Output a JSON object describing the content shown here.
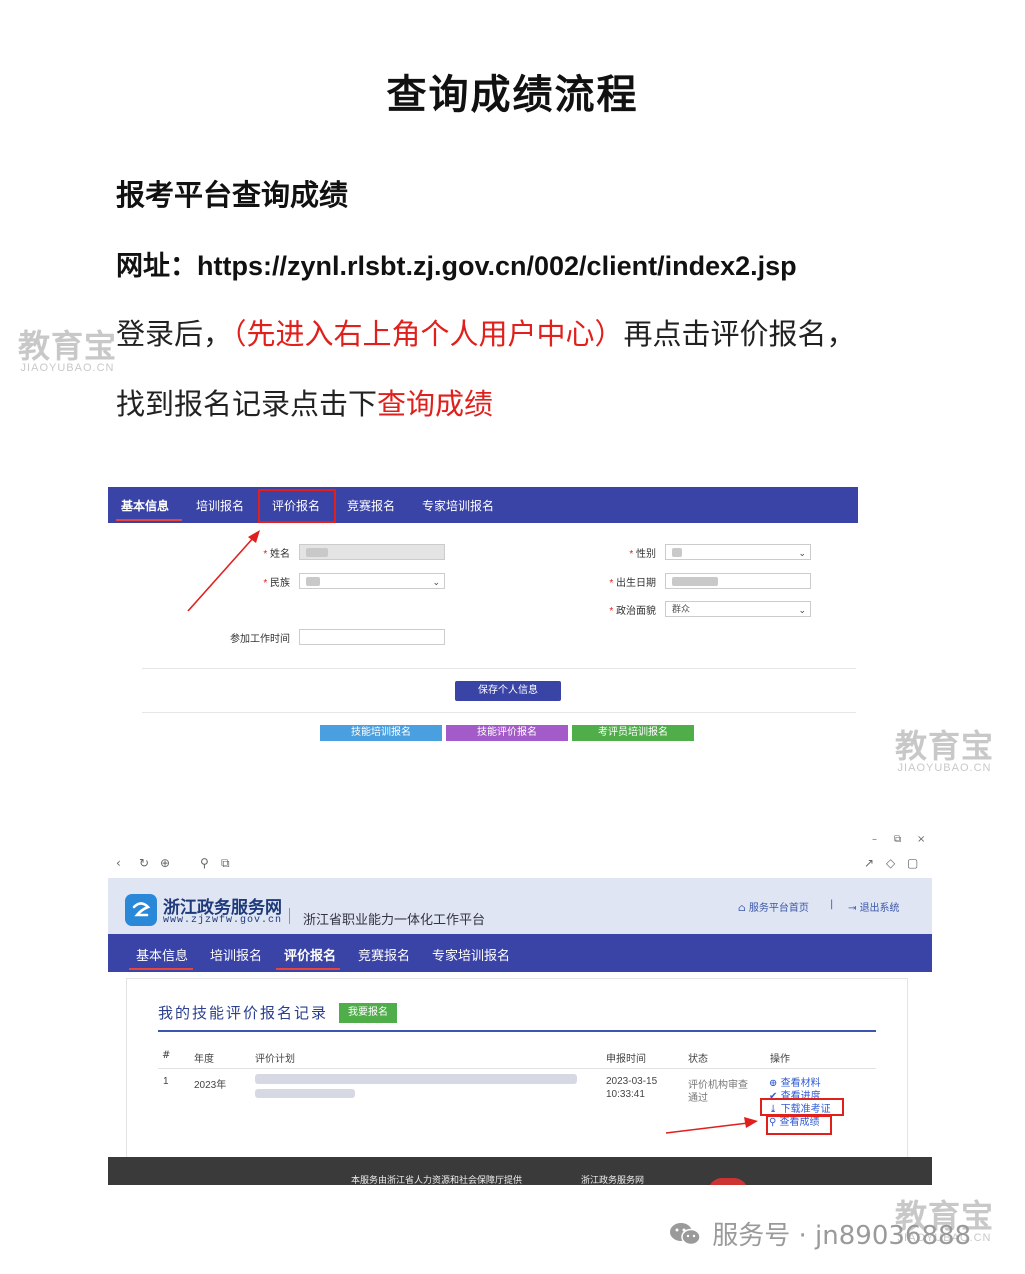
{
  "document": {
    "title": "查询成绩流程",
    "section_heading": "报考平台查询成绩",
    "url_label": "网址：",
    "url": "https://zynl.rlsbt.zj.gov.cn/002/client/index2.jsp",
    "line1_pre": "登录后，",
    "line1_red": "（先进入右上角个人用户中心）",
    "line1_post": "再点击评价报名，",
    "line2_pre": "找到报名记录点击下",
    "line2_red": "查询成绩"
  },
  "watermark": {
    "text": "教育宝",
    "sub": "JIAOYUBAO.CN"
  },
  "screenshot1": {
    "tabs": [
      "基本信息",
      "培训报名",
      "评价报名",
      "竞赛报名",
      "专家培训报名"
    ],
    "fields": {
      "name_label": "姓名",
      "gender_label": "性别",
      "ethnicity_label": "民族",
      "birth_label": "出生日期",
      "political_label": "政治面貌",
      "political_value": "群众",
      "work_start_label": "参加工作时间"
    },
    "save_button": "保存个人信息",
    "bottom_buttons": [
      "技能培训报名",
      "技能评价报名",
      "考评员培训报名"
    ]
  },
  "screenshot2": {
    "window_controls": [
      "–",
      "⧉",
      "×"
    ],
    "site_name": "浙江政务服务网",
    "site_url": "www.zjzwfw.gov.cn",
    "platform_name": "浙江省职业能力一体化工作平台",
    "header_links": [
      "服务平台首页",
      "退出系统"
    ],
    "header_sep": "|",
    "tabs": [
      "基本信息",
      "培训报名",
      "评价报名",
      "竞赛报名",
      "专家培训报名"
    ],
    "records_title": "我的技能评价报名记录",
    "signup_button": "我要报名",
    "table_headers": [
      "#",
      "年度",
      "评价计划",
      "申报时间",
      "状态",
      "操作"
    ],
    "row": {
      "index": "1",
      "year": "2023年",
      "date": "2023-03-15",
      "time": "10:33:41",
      "status_line1": "评价机构审查",
      "status_line2": "通过",
      "actions": [
        "查看材料",
        "查看进度",
        "下载准考证",
        "查看成绩"
      ]
    },
    "footer_left": "本服务由浙江省人力资源和社会保障厅提供",
    "footer_right": "浙江政务服务网"
  },
  "wechat": {
    "text": "服务号 · jn89036888"
  },
  "colors": {
    "nav": "#3a43a6",
    "red": "#e0201c",
    "btn_blue": "#4a9fe0",
    "btn_purple": "#a35bc9",
    "btn_green": "#4fae4a"
  }
}
